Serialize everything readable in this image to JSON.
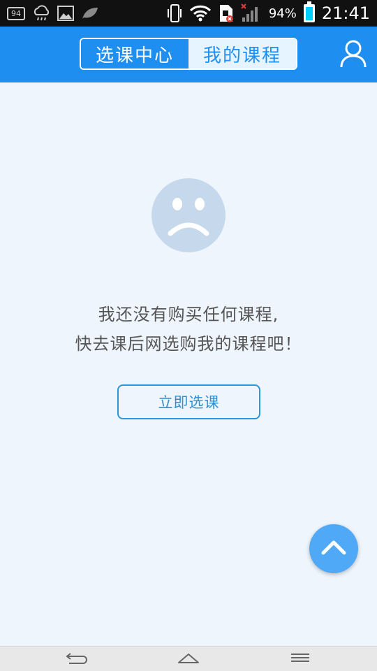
{
  "status_bar": {
    "notification_badge": "94",
    "battery_percent": "94%",
    "time": "21:41",
    "icons": [
      "notification-94-icon",
      "weather-icon",
      "gallery-icon",
      "leaf-icon",
      "vibrate-icon",
      "wifi-icon",
      "sim-icon",
      "signal-icon",
      "battery-icon"
    ]
  },
  "header": {
    "tabs": [
      {
        "label": "选课中心",
        "active": false
      },
      {
        "label": "我的课程",
        "active": true
      }
    ],
    "user_icon": "user-icon"
  },
  "empty_state": {
    "line1": "我还没有购买任何课程,",
    "line2": "快去课后网选购我的课程吧！",
    "button_label": "立即选课",
    "icon": "sad-face-icon"
  },
  "fab": {
    "icon": "chevron-up-icon"
  },
  "nav_bar": {
    "icons": [
      "back-icon",
      "home-icon",
      "menu-icon"
    ]
  },
  "colors": {
    "header_bg": "#1e8ef1",
    "page_bg": "#eef5fc",
    "face": "#c6d8ec",
    "button_border": "#2e96d6",
    "fab": "#4fa9f6"
  }
}
